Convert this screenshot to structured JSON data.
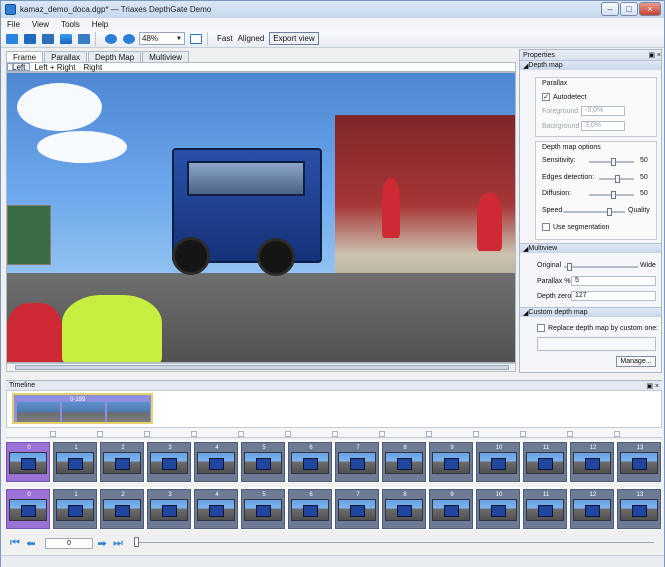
{
  "window": {
    "title": "kamaz_demo_doca.dgp* — Triaxes DepthGate Demo"
  },
  "menu": [
    "File",
    "View",
    "Tools",
    "Help"
  ],
  "toolbar": {
    "zoom": "48%",
    "fast": "Fast",
    "aligned": "Aligned",
    "export_view": "Export view"
  },
  "view_tabs": [
    "Frame",
    "Parallax",
    "Depth Map",
    "Multiview"
  ],
  "sub_tabs": [
    "Left",
    "Left + Right",
    "Right"
  ],
  "properties": {
    "title": "Properties",
    "depth_map": {
      "title": "Depth map",
      "parallax": "Parallax",
      "autodetect": "Autodetect",
      "foreground_label": "Foreground",
      "foreground": "-3,0%",
      "background_label": "Background",
      "background": "3,0%",
      "options_title": "Depth map options",
      "sensitivity_label": "Sensitivity:",
      "sensitivity": "50",
      "edges_label": "Edges detection:",
      "edges": "50",
      "diffusion_label": "Diffusion:",
      "diffusion": "50",
      "speed": "Speed",
      "quality": "Quality",
      "segmentation": "Use segmentation"
    },
    "multiview": {
      "title": "Multiview",
      "original": "Original",
      "wide": "Wide",
      "parallax_label": "Parallax %",
      "parallax": "5",
      "depth_zero_label": "Depth zero",
      "depth_zero": "127"
    },
    "custom_depth_map": {
      "title": "Custom depth map",
      "replace": "Replace depth map by custom one:",
      "manage": "Manage..."
    }
  },
  "timeline": {
    "title": "Timeline",
    "clip_range": "0-199",
    "frames": [
      "0",
      "1",
      "2",
      "3",
      "4",
      "5",
      "6",
      "7",
      "8",
      "9",
      "10",
      "11",
      "12",
      "13"
    ],
    "current_frame": "0"
  }
}
